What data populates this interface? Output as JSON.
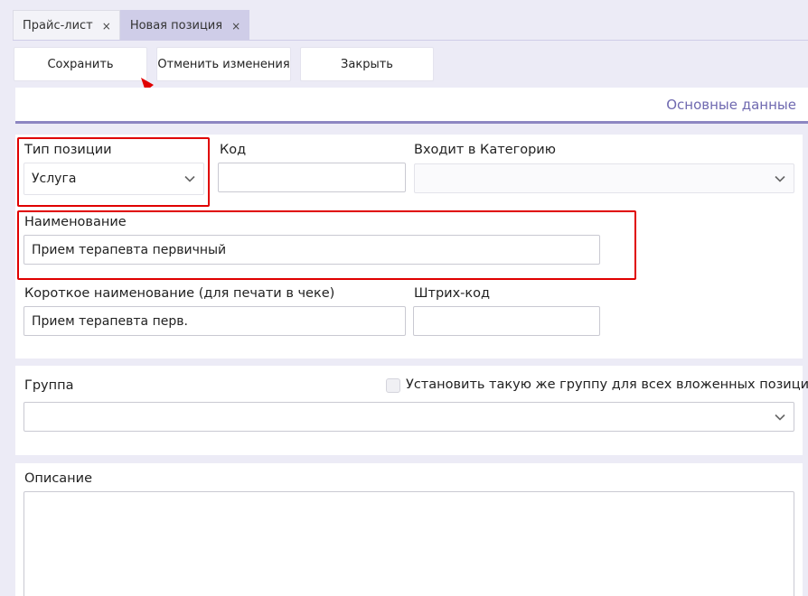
{
  "tabs": [
    {
      "label": "Прайс-лист",
      "close": "×",
      "active": false
    },
    {
      "label": "Новая позиция",
      "close": "×",
      "active": true
    }
  ],
  "toolbar": {
    "save_label": "Сохранить",
    "cancel_label": "Отменить изменения",
    "close_label": "Закрыть"
  },
  "section": {
    "title": "Основные данные"
  },
  "form": {
    "type_label": "Тип позиции",
    "type_value": "Услуга",
    "code_label": "Код",
    "code_value": "",
    "category_label": "Входит в Категорию",
    "category_value": "",
    "name_label": "Наименование",
    "name_value": "Прием терапевта первичный",
    "short_name_label": "Короткое наименование (для печати в чеке)",
    "short_name_value": "Прием терапевта перв.",
    "barcode_label": "Штрих-код",
    "barcode_value": ""
  },
  "group": {
    "label": "Группа",
    "checkbox_label": "Установить такую же группу для всех вложенных позиций",
    "checked": false,
    "value": ""
  },
  "description": {
    "label": "Описание",
    "value": ""
  },
  "colors": {
    "accent": "#8d86c2",
    "accent_text": "#6f69b0",
    "active_tab": "#cfcde8",
    "highlight": "#e00000",
    "background": "#ecebf6"
  }
}
